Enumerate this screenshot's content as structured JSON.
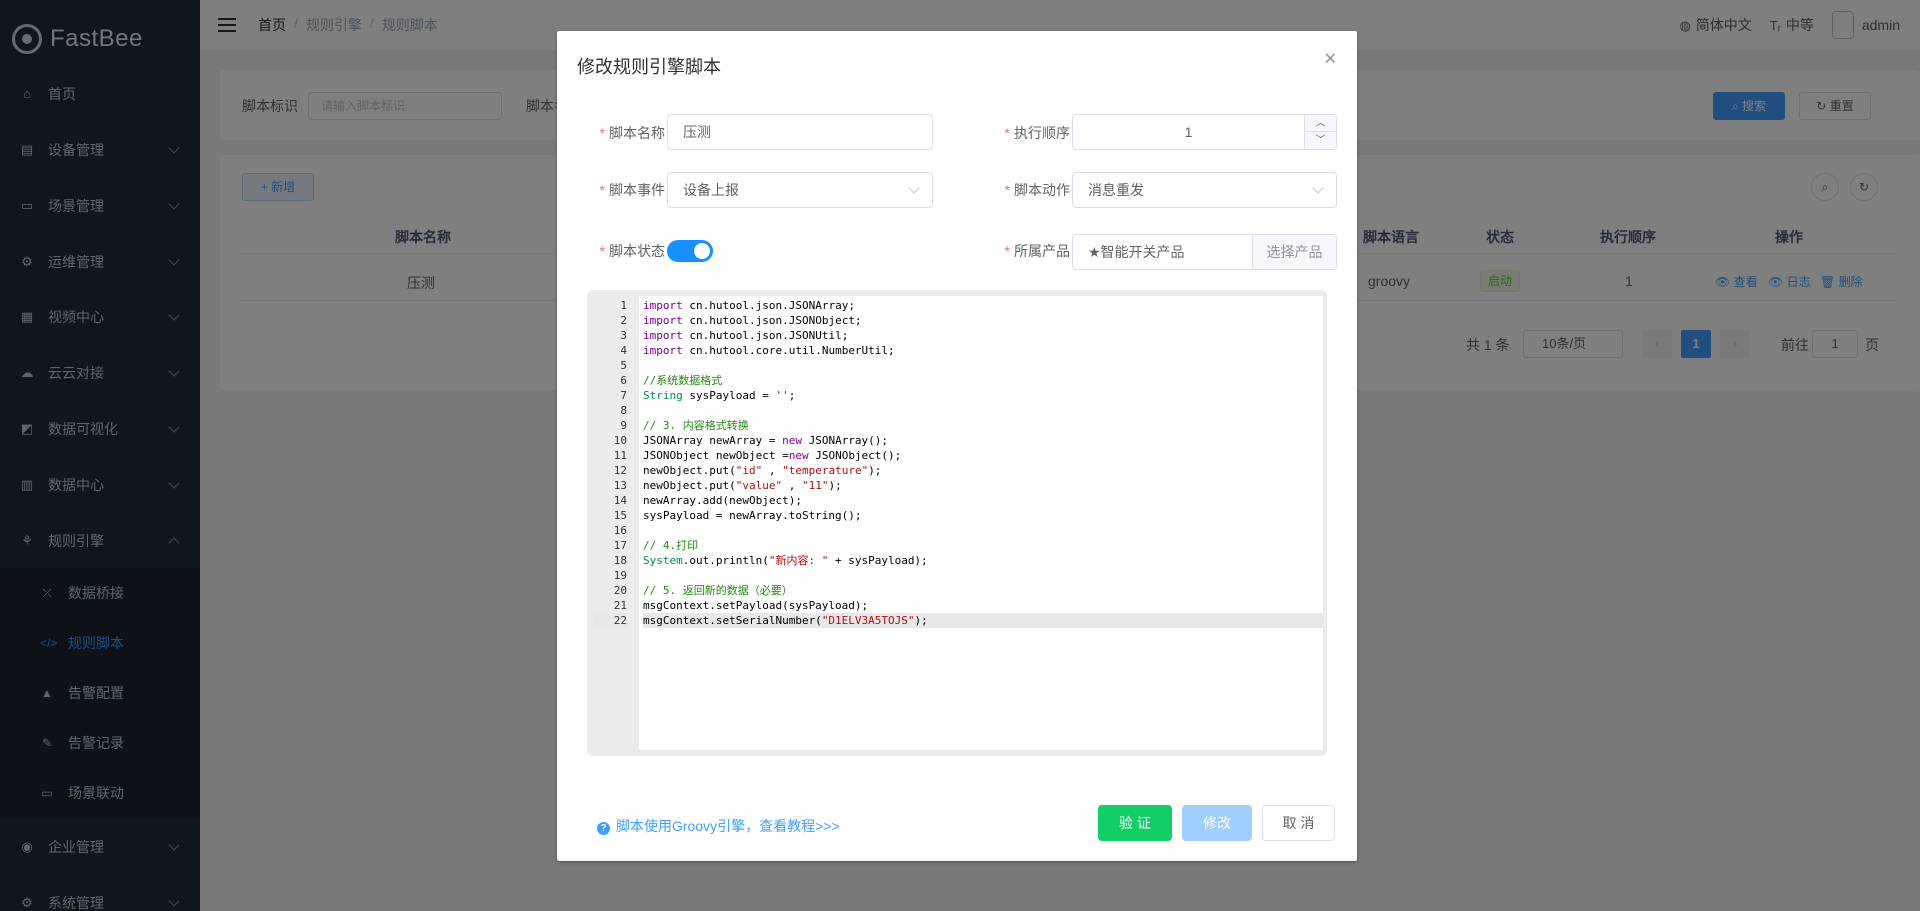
{
  "app": {
    "name": "FastBee"
  },
  "sidebar": {
    "items": [
      {
        "label": "首页",
        "icon": "home-icon",
        "glyph": "⌂"
      },
      {
        "label": "设备管理",
        "icon": "device-icon",
        "glyph": "▤"
      },
      {
        "label": "场景管理",
        "icon": "scene-icon",
        "glyph": "▭"
      },
      {
        "label": "运维管理",
        "icon": "ops-icon",
        "glyph": "⚙"
      },
      {
        "label": "视频中心",
        "icon": "video-icon",
        "glyph": "▦"
      },
      {
        "label": "云云对接",
        "icon": "cloud-icon",
        "glyph": "☁"
      },
      {
        "label": "数据可视化",
        "icon": "chart-icon",
        "glyph": "◩"
      },
      {
        "label": "数据中心",
        "icon": "data-icon",
        "glyph": "▥"
      },
      {
        "label": "规则引擎",
        "icon": "rule-icon",
        "glyph": "⚘"
      },
      {
        "label": "企业管理",
        "icon": "enterprise-icon",
        "glyph": "◉"
      },
      {
        "label": "系统管理",
        "icon": "system-icon",
        "glyph": "⚙"
      }
    ],
    "submenu": [
      {
        "label": "数据桥接",
        "glyph": "⤫"
      },
      {
        "label": "规则脚本",
        "glyph": "</>"
      },
      {
        "label": "告警配置",
        "glyph": "▲"
      },
      {
        "label": "告警记录",
        "glyph": "✎"
      },
      {
        "label": "场景联动",
        "glyph": "▭"
      }
    ]
  },
  "header": {
    "breadcrumb": [
      "首页",
      "规则引擎",
      "规则脚本"
    ],
    "language": "简体中文",
    "size": "中等",
    "user": "admin"
  },
  "search": {
    "label1": "脚本标识",
    "placeholder1": "请输入脚本标识",
    "label2": "脚本名",
    "search_btn": "搜索",
    "reset_btn": "重置"
  },
  "table": {
    "add_btn": "新增",
    "columns": [
      "脚本名称",
      "脚本语言",
      "状态",
      "执行顺序",
      "操作"
    ],
    "rows": [
      {
        "name": "压测",
        "language": "groovy",
        "status": "启动",
        "order": "1"
      }
    ],
    "ops": [
      "查看",
      "日志",
      "删除"
    ],
    "pagination": {
      "total": "共 1 条",
      "page_size": "10条/页",
      "current": "1",
      "goto_label": "前往",
      "goto_value": "1",
      "page_unit": "页"
    }
  },
  "dialog": {
    "title": "修改规则引擎脚本",
    "fields": {
      "name_label": "脚本名称",
      "name_value": "压测",
      "order_label": "执行顺序",
      "order_value": "1",
      "event_label": "脚本事件",
      "event_value": "设备上报",
      "action_label": "脚本动作",
      "action_value": "消息重发",
      "status_label": "脚本状态",
      "product_label": "所属产品",
      "product_value": "★智能开关产品",
      "product_btn": "选择产品"
    },
    "help_link": "脚本使用Groovy引擎，查看教程>>>",
    "buttons": {
      "verify": "验 证",
      "modify": "修改",
      "cancel": "取 消"
    },
    "code_lines": [
      "import cn.hutool.json.JSONArray;",
      "import cn.hutool.json.JSONObject;",
      "import cn.hutool.json.JSONUtil;",
      "import cn.hutool.core.util.NumberUtil;",
      "",
      "//系统数据格式",
      "String sysPayload = '';",
      "",
      "// 3. 内容格式转换",
      "JSONArray newArray = new JSONArray();",
      "JSONObject newObject =new JSONObject();",
      "newObject.put(\"id\" , \"temperature\");",
      "newObject.put(\"value\" , \"11\");",
      "newArray.add(newObject);",
      "sysPayload = newArray.toString();",
      "",
      "// 4.打印",
      "System.out.println(\"新内容: \" + sysPayload);",
      "",
      "// 5. 返回新的数据（必要）",
      "msgContext.setPayload(sysPayload);",
      "msgContext.setSerialNumber(\"D1ELV3A5TOJS\");"
    ]
  },
  "colors": {
    "primary": "#409eff",
    "success": "#13ce66",
    "sidebar_bg": "#1f2d3d",
    "switch_on": "#1890ff"
  }
}
